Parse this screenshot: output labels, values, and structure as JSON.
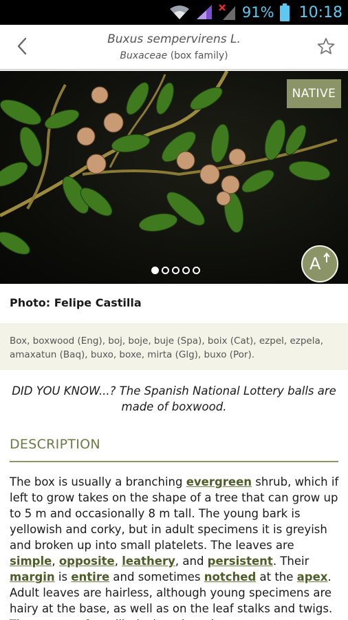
{
  "status_bar": {
    "battery_pct": "91%",
    "time": "10:18",
    "icons": [
      "wifi-icon",
      "signal-icon",
      "no-sim-signal-icon",
      "battery-icon"
    ]
  },
  "app_bar": {
    "scientific_name": "Buxus sempervirens L.",
    "family_latin": "Buxaceae",
    "family_common": " (box family)",
    "back_icon": "back-chevron-icon",
    "favorite_icon": "star-outline-icon"
  },
  "photo": {
    "badge": "NATIVE",
    "carousel": {
      "count": 5,
      "active_index": 0
    },
    "font_button_label": "A",
    "font_button_icon": "text-size-up-icon"
  },
  "credit": "Photo: Felipe Castilla",
  "common_names": "Box, boxwood (Eng), boj, boje, buje (Spa), boix (Cat), ezpel, ezpela, amaxatun (Baq), buxo, boxe, mirta (Glg), buxo (Por).",
  "did_you_know": "DID YOU KNOW...? The Spanish National Lottery balls are made of boxwood.",
  "description": {
    "heading": "DESCRIPTION",
    "segments": [
      {
        "t": "The box is usually a branching "
      },
      {
        "t": "evergreen",
        "link": true
      },
      {
        "t": " shrub, which if left to grow takes on the shape of a tree that can grow up to 5 m and occasionally 8 m tall. The young bark is yellowish and corky, but in adult specimens it is greyish and broken up into small platelets. The leaves are "
      },
      {
        "t": "simple",
        "link": true
      },
      {
        "t": ", "
      },
      {
        "t": "opposite",
        "link": true
      },
      {
        "t": ", "
      },
      {
        "t": "leathery",
        "link": true
      },
      {
        "t": ", and "
      },
      {
        "t": "persistent",
        "link": true
      },
      {
        "t": ". Their "
      },
      {
        "t": "margin",
        "link": true
      },
      {
        "t": " is "
      },
      {
        "t": "entire",
        "link": true
      },
      {
        "t": " and sometimes "
      },
      {
        "t": "notched",
        "link": true
      },
      {
        "t": " at the "
      },
      {
        "t": "apex",
        "link": true
      },
      {
        "t": ". Adult leaves are hairless, although young specimens are hairy at the base, as well as on the leaf stalks and twigs. They are "
      },
      {
        "t": "oval",
        "link": true
      },
      {
        "t": " to elliptical, and tend"
      }
    ]
  },
  "colors": {
    "accent": "#8a9466",
    "accent_text": "#6b7a47",
    "band_bg": "#f4f3e7",
    "status_icons": "#5ec8f0"
  }
}
